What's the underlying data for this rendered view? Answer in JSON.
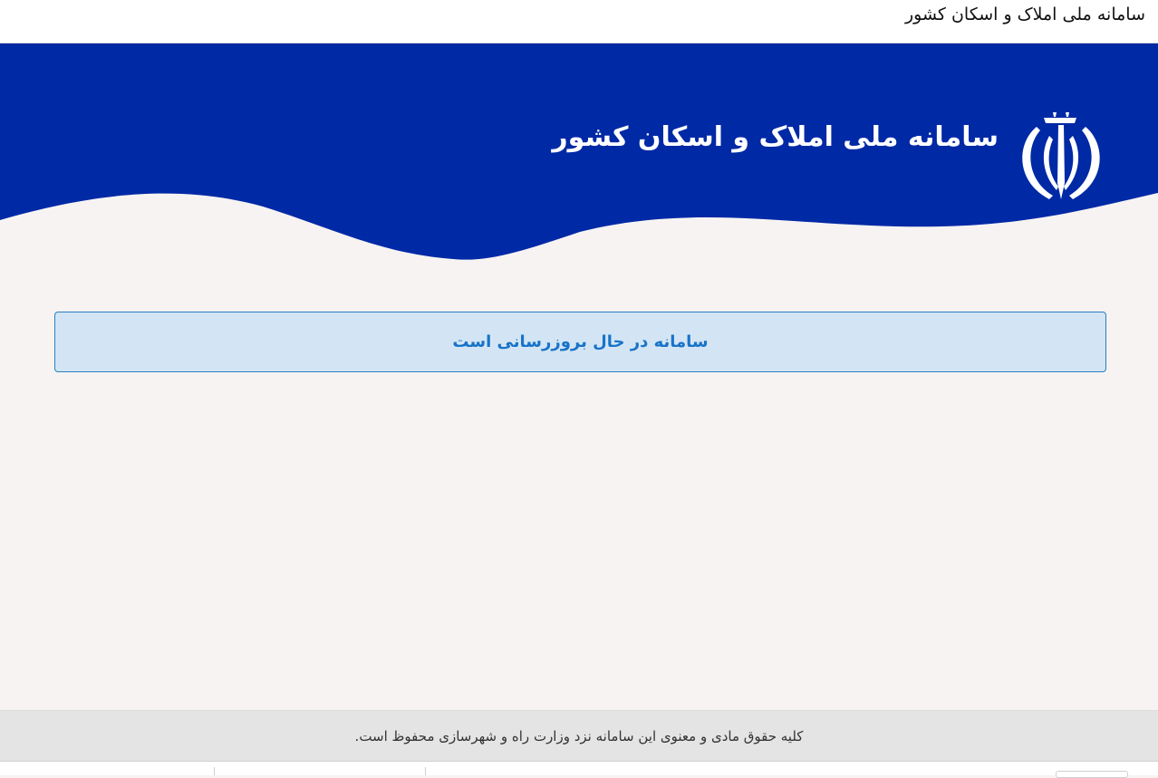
{
  "window": {
    "title": "سامانه ملی املاک و اسکان کشور"
  },
  "header": {
    "site_title": "سامانه ملی املاک و اسکان کشور",
    "emblem_icon": "iran-emblem-icon",
    "brand_color": "#0029a6"
  },
  "notice": {
    "message": "سامانه در حال بروزرسانی است",
    "text_color": "#1873c8",
    "background_color": "#d3e5f4"
  },
  "footer": {
    "copyright": "کلیه حقوق مادی و معنوی این سامانه نزد وزارت راه و شهرسازی محفوظ است."
  }
}
